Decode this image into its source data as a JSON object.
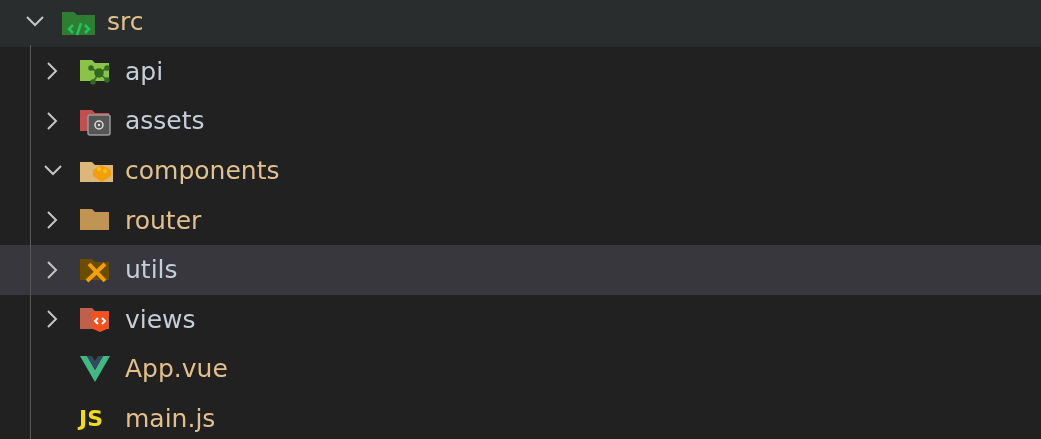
{
  "tree": [
    {
      "label": "src",
      "kind": "folder",
      "expanded": true,
      "modified": true,
      "selected": false,
      "hovered": true,
      "children": [
        {
          "label": "api",
          "kind": "folder",
          "expanded": false,
          "modified": false,
          "selected": false,
          "hovered": false
        },
        {
          "label": "assets",
          "kind": "folder",
          "expanded": false,
          "modified": false,
          "selected": false,
          "hovered": false
        },
        {
          "label": "components",
          "kind": "folder",
          "expanded": true,
          "modified": true,
          "selected": false,
          "hovered": false
        },
        {
          "label": "router",
          "kind": "folder",
          "expanded": false,
          "modified": true,
          "selected": false,
          "hovered": false
        },
        {
          "label": "utils",
          "kind": "folder",
          "expanded": false,
          "modified": false,
          "selected": true,
          "hovered": false
        },
        {
          "label": "views",
          "kind": "folder",
          "expanded": false,
          "modified": false,
          "selected": false,
          "hovered": false
        },
        {
          "label": "App.vue",
          "kind": "file",
          "modified": true,
          "selected": false,
          "hovered": false
        },
        {
          "label": "main.js",
          "kind": "file",
          "icon_text": "JS",
          "modified": true,
          "selected": false,
          "hovered": false
        }
      ]
    }
  ]
}
